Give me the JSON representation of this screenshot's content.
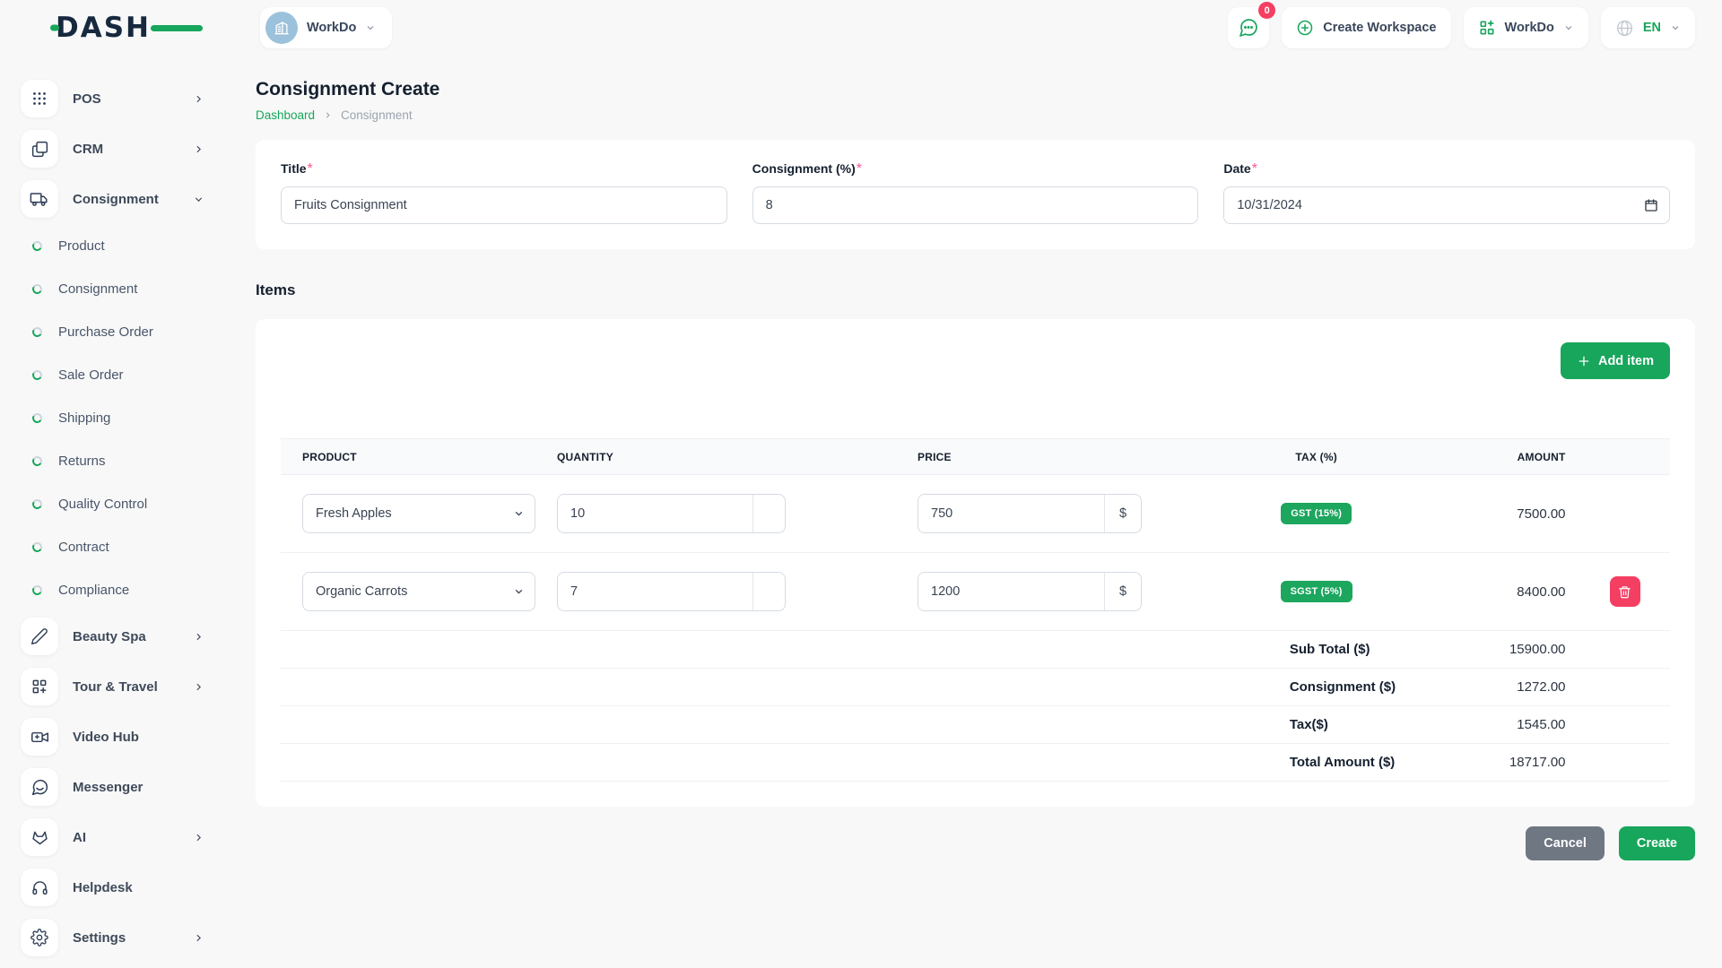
{
  "brand": {
    "name": "DASH"
  },
  "header": {
    "workspace_label": "WorkDo",
    "notification_count": "0",
    "create_workspace_label": "Create Workspace",
    "workdo_label": "WorkDo",
    "language": "EN"
  },
  "page": {
    "title": "Consignment Create",
    "breadcrumb": {
      "home": "Dashboard",
      "current": "Consignment"
    }
  },
  "sidebar": {
    "items": [
      {
        "label": "POS"
      },
      {
        "label": "CRM"
      },
      {
        "label": "Consignment"
      },
      {
        "label": "Beauty Spa"
      },
      {
        "label": "Tour & Travel"
      },
      {
        "label": "Video Hub"
      },
      {
        "label": "Messenger"
      },
      {
        "label": "AI"
      },
      {
        "label": "Helpdesk"
      },
      {
        "label": "Settings"
      }
    ],
    "consignment_children": [
      "Product",
      "Consignment",
      "Purchase Order",
      "Sale Order",
      "Shipping",
      "Returns",
      "Quality Control",
      "Contract",
      "Compliance"
    ]
  },
  "form": {
    "required_mark": "*",
    "title": {
      "label": "Title",
      "value": "Fruits Consignment"
    },
    "consignment_pct": {
      "label": "Consignment (%)",
      "value": "8"
    },
    "date": {
      "label": "Date",
      "value": "10/31/2024"
    }
  },
  "items": {
    "heading": "Items",
    "add_item_label": "Add item",
    "columns": [
      "PRODUCT",
      "QUANTITY",
      "PRICE",
      "TAX (%)",
      "AMOUNT"
    ],
    "rows": [
      {
        "product": "Fresh Apples",
        "quantity": "10",
        "price": "750",
        "currency": "$",
        "tax": "GST (15%)",
        "amount": "7500.00"
      },
      {
        "product": "Organic Carrots",
        "quantity": "7",
        "price": "1200",
        "currency": "$",
        "tax": "SGST (5%)",
        "amount": "8400.00"
      }
    ],
    "totals": [
      {
        "label": "Sub Total ($)",
        "value": "15900.00"
      },
      {
        "label": "Consignment ($)",
        "value": "1272.00"
      },
      {
        "label": "Tax($)",
        "value": "1545.00"
      },
      {
        "label": "Total Amount ($)",
        "value": "18717.00"
      }
    ]
  },
  "actions": {
    "cancel_label": "Cancel",
    "create_label": "Create"
  },
  "colors": {
    "primary_green": "#17a65b",
    "danger_pink": "#f43f63",
    "navy": "#16293e",
    "background": "#f8f8f8"
  }
}
